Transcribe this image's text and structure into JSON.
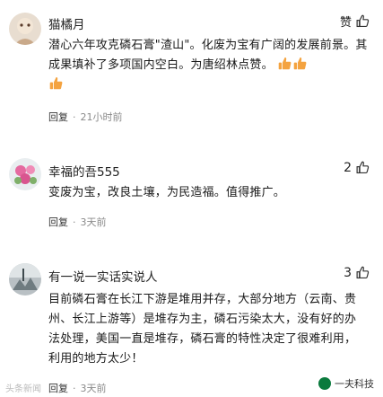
{
  "comments": [
    {
      "user": "猫橘月",
      "like_label": "赞",
      "text": "潜心六年攻克磷石膏\"渣山\"。化废为宝有广阔的发展前景。其成果填补了多项国内空白。为唐绍林点赞。",
      "reply_label": "回复",
      "separator": "·",
      "time": "21小时前"
    },
    {
      "user": "幸福的吾555",
      "like_count": "2",
      "text": "变废为宝，改良土壤，为民造福。值得推广。",
      "reply_label": "回复",
      "separator": "·",
      "time": "3天前"
    },
    {
      "user": "有一说一实话实说人",
      "like_count": "3",
      "text": "目前磷石膏在长江下游是堆用并存，大部分地方（云南、贵州、长江上游等）是堆存为主，磷石污染太大，没有好的办法处理，美国一直是堆存，磷石膏的特性决定了很难利用，利用的地方太少！",
      "reply_label": "回复",
      "separator": "·",
      "time": "3天前"
    }
  ],
  "watermark": {
    "left": "头条新闻",
    "right": "一夫科技"
  },
  "colors": {
    "emoji": "#f4a340",
    "meta": "#8a8a8a"
  },
  "icons": [
    "thumbs-up-icon",
    "thumbs-up-emoji-icon"
  ]
}
